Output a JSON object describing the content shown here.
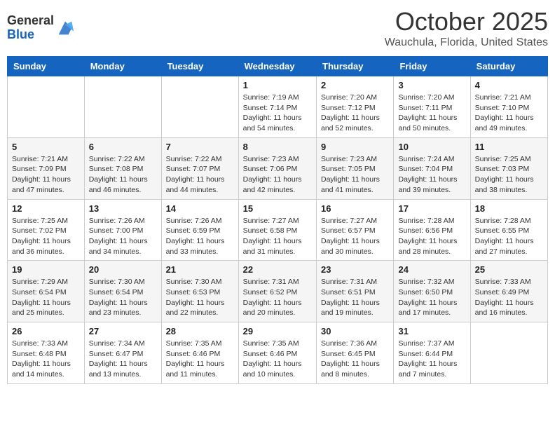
{
  "header": {
    "logo_general": "General",
    "logo_blue": "Blue",
    "month": "October 2025",
    "location": "Wauchula, Florida, United States"
  },
  "days_of_week": [
    "Sunday",
    "Monday",
    "Tuesday",
    "Wednesday",
    "Thursday",
    "Friday",
    "Saturday"
  ],
  "weeks": [
    [
      {
        "day": "",
        "info": ""
      },
      {
        "day": "",
        "info": ""
      },
      {
        "day": "",
        "info": ""
      },
      {
        "day": "1",
        "info": "Sunrise: 7:19 AM\nSunset: 7:14 PM\nDaylight: 11 hours\nand 54 minutes."
      },
      {
        "day": "2",
        "info": "Sunrise: 7:20 AM\nSunset: 7:12 PM\nDaylight: 11 hours\nand 52 minutes."
      },
      {
        "day": "3",
        "info": "Sunrise: 7:20 AM\nSunset: 7:11 PM\nDaylight: 11 hours\nand 50 minutes."
      },
      {
        "day": "4",
        "info": "Sunrise: 7:21 AM\nSunset: 7:10 PM\nDaylight: 11 hours\nand 49 minutes."
      }
    ],
    [
      {
        "day": "5",
        "info": "Sunrise: 7:21 AM\nSunset: 7:09 PM\nDaylight: 11 hours\nand 47 minutes."
      },
      {
        "day": "6",
        "info": "Sunrise: 7:22 AM\nSunset: 7:08 PM\nDaylight: 11 hours\nand 46 minutes."
      },
      {
        "day": "7",
        "info": "Sunrise: 7:22 AM\nSunset: 7:07 PM\nDaylight: 11 hours\nand 44 minutes."
      },
      {
        "day": "8",
        "info": "Sunrise: 7:23 AM\nSunset: 7:06 PM\nDaylight: 11 hours\nand 42 minutes."
      },
      {
        "day": "9",
        "info": "Sunrise: 7:23 AM\nSunset: 7:05 PM\nDaylight: 11 hours\nand 41 minutes."
      },
      {
        "day": "10",
        "info": "Sunrise: 7:24 AM\nSunset: 7:04 PM\nDaylight: 11 hours\nand 39 minutes."
      },
      {
        "day": "11",
        "info": "Sunrise: 7:25 AM\nSunset: 7:03 PM\nDaylight: 11 hours\nand 38 minutes."
      }
    ],
    [
      {
        "day": "12",
        "info": "Sunrise: 7:25 AM\nSunset: 7:02 PM\nDaylight: 11 hours\nand 36 minutes."
      },
      {
        "day": "13",
        "info": "Sunrise: 7:26 AM\nSunset: 7:00 PM\nDaylight: 11 hours\nand 34 minutes."
      },
      {
        "day": "14",
        "info": "Sunrise: 7:26 AM\nSunset: 6:59 PM\nDaylight: 11 hours\nand 33 minutes."
      },
      {
        "day": "15",
        "info": "Sunrise: 7:27 AM\nSunset: 6:58 PM\nDaylight: 11 hours\nand 31 minutes."
      },
      {
        "day": "16",
        "info": "Sunrise: 7:27 AM\nSunset: 6:57 PM\nDaylight: 11 hours\nand 30 minutes."
      },
      {
        "day": "17",
        "info": "Sunrise: 7:28 AM\nSunset: 6:56 PM\nDaylight: 11 hours\nand 28 minutes."
      },
      {
        "day": "18",
        "info": "Sunrise: 7:28 AM\nSunset: 6:55 PM\nDaylight: 11 hours\nand 27 minutes."
      }
    ],
    [
      {
        "day": "19",
        "info": "Sunrise: 7:29 AM\nSunset: 6:54 PM\nDaylight: 11 hours\nand 25 minutes."
      },
      {
        "day": "20",
        "info": "Sunrise: 7:30 AM\nSunset: 6:54 PM\nDaylight: 11 hours\nand 23 minutes."
      },
      {
        "day": "21",
        "info": "Sunrise: 7:30 AM\nSunset: 6:53 PM\nDaylight: 11 hours\nand 22 minutes."
      },
      {
        "day": "22",
        "info": "Sunrise: 7:31 AM\nSunset: 6:52 PM\nDaylight: 11 hours\nand 20 minutes."
      },
      {
        "day": "23",
        "info": "Sunrise: 7:31 AM\nSunset: 6:51 PM\nDaylight: 11 hours\nand 19 minutes."
      },
      {
        "day": "24",
        "info": "Sunrise: 7:32 AM\nSunset: 6:50 PM\nDaylight: 11 hours\nand 17 minutes."
      },
      {
        "day": "25",
        "info": "Sunrise: 7:33 AM\nSunset: 6:49 PM\nDaylight: 11 hours\nand 16 minutes."
      }
    ],
    [
      {
        "day": "26",
        "info": "Sunrise: 7:33 AM\nSunset: 6:48 PM\nDaylight: 11 hours\nand 14 minutes."
      },
      {
        "day": "27",
        "info": "Sunrise: 7:34 AM\nSunset: 6:47 PM\nDaylight: 11 hours\nand 13 minutes."
      },
      {
        "day": "28",
        "info": "Sunrise: 7:35 AM\nSunset: 6:46 PM\nDaylight: 11 hours\nand 11 minutes."
      },
      {
        "day": "29",
        "info": "Sunrise: 7:35 AM\nSunset: 6:46 PM\nDaylight: 11 hours\nand 10 minutes."
      },
      {
        "day": "30",
        "info": "Sunrise: 7:36 AM\nSunset: 6:45 PM\nDaylight: 11 hours\nand 8 minutes."
      },
      {
        "day": "31",
        "info": "Sunrise: 7:37 AM\nSunset: 6:44 PM\nDaylight: 11 hours\nand 7 minutes."
      },
      {
        "day": "",
        "info": ""
      }
    ]
  ]
}
